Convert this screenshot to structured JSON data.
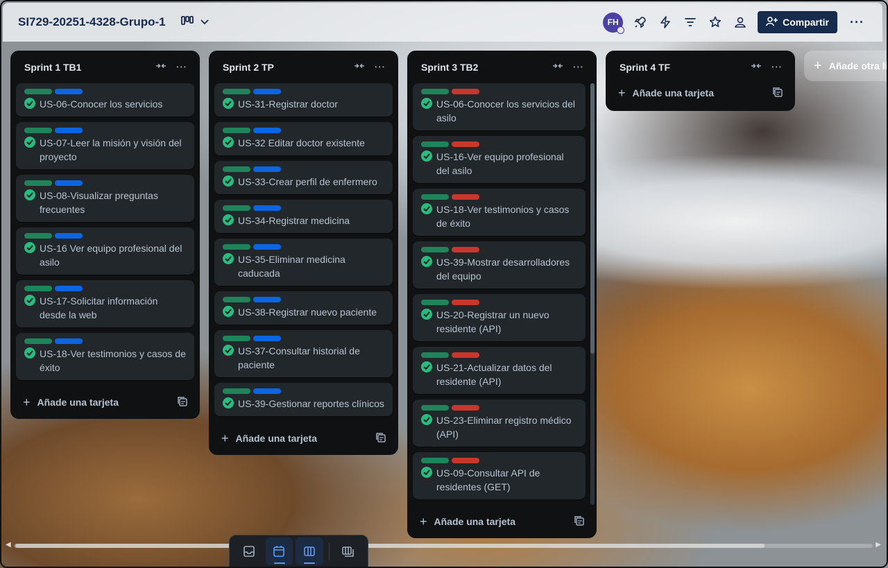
{
  "board": {
    "title": "SI729-20251-4328-Grupo-1",
    "view_icon": "board-view-icon"
  },
  "header": {
    "avatar_initials": "FH",
    "share_label": "Compartir",
    "icons": [
      "rocket-icon",
      "lightning-icon",
      "filter-icon",
      "star-icon",
      "team-icon"
    ],
    "more_label": "···"
  },
  "colors": {
    "label_green": "#1f845a",
    "label_blue": "#0c66e4",
    "label_red": "#c9372c",
    "check_green": "#2abb7f",
    "share_bg": "#172b4d"
  },
  "lists": [
    {
      "title": "Sprint 1 TB1",
      "add_card_label": "Añade una tarjeta",
      "cards": [
        {
          "title": "US-06-Conocer los servicios",
          "labels": [
            "green",
            "blue"
          ]
        },
        {
          "title": "US-07-Leer la misión y visión del proyecto",
          "labels": [
            "green",
            "blue"
          ]
        },
        {
          "title": "US-08-Visualizar preguntas frecuentes",
          "labels": [
            "green",
            "blue"
          ]
        },
        {
          "title": "US-16 Ver equipo profesional del asilo",
          "labels": [
            "green",
            "blue"
          ]
        },
        {
          "title": "US-17-Solicitar información desde la web",
          "labels": [
            "green",
            "blue"
          ]
        },
        {
          "title": "US-18-Ver testimonios y casos de éxito",
          "labels": [
            "green",
            "blue"
          ]
        }
      ]
    },
    {
      "title": "Sprint 2 TP",
      "add_card_label": "Añade una tarjeta",
      "cards": [
        {
          "title": "US-31-Registrar doctor",
          "labels": [
            "green",
            "blue"
          ]
        },
        {
          "title": "US-32 Editar doctor existente",
          "labels": [
            "green",
            "blue"
          ]
        },
        {
          "title": "US-33-Crear perfil de enfermero",
          "labels": [
            "green",
            "blue"
          ]
        },
        {
          "title": "US-34-Registrar medicina",
          "labels": [
            "green",
            "blue"
          ]
        },
        {
          "title": "US-35-Eliminar medicina caducada",
          "labels": [
            "green",
            "blue"
          ]
        },
        {
          "title": "US-38-Registrar nuevo paciente",
          "labels": [
            "green",
            "blue"
          ]
        },
        {
          "title": "US-37-Consultar historial de paciente",
          "labels": [
            "green",
            "blue"
          ]
        },
        {
          "title": "US-39-Gestionar reportes clínicos",
          "labels": [
            "green",
            "blue"
          ]
        }
      ]
    },
    {
      "title": "Sprint 3 TB2",
      "add_card_label": "Añade una tarjeta",
      "cards": [
        {
          "title": "US-06-Conocer los servicios del asilo",
          "labels": [
            "green",
            "red"
          ]
        },
        {
          "title": "US-16-Ver equipo profesional del asilo",
          "labels": [
            "green",
            "red"
          ]
        },
        {
          "title": "US-18-Ver testimonios y casos de éxito",
          "labels": [
            "green",
            "red"
          ]
        },
        {
          "title": "US-39-Mostrar desarrolladores del equipo",
          "labels": [
            "green",
            "red"
          ]
        },
        {
          "title": "US-20-Registrar un nuevo residente (API)",
          "labels": [
            "green",
            "red"
          ]
        },
        {
          "title": "US-21-Actualizar datos del residente (API)",
          "labels": [
            "green",
            "red"
          ]
        },
        {
          "title": "US-23-Eliminar registro médico (API)",
          "labels": [
            "green",
            "red"
          ]
        },
        {
          "title": "US-09-Consultar API de residentes (GET)",
          "labels": [
            "green",
            "red"
          ]
        }
      ]
    },
    {
      "title": "Sprint 4 TF",
      "add_card_label": "Añade una tarjeta",
      "cards": []
    }
  ],
  "add_list_label": "Añade otra lista",
  "bottom_bar": {
    "buttons": [
      "inbox-icon",
      "planner-icon",
      "board-icon",
      "switch-boards-icon"
    ],
    "active": [
      "planner-icon",
      "board-icon"
    ]
  }
}
